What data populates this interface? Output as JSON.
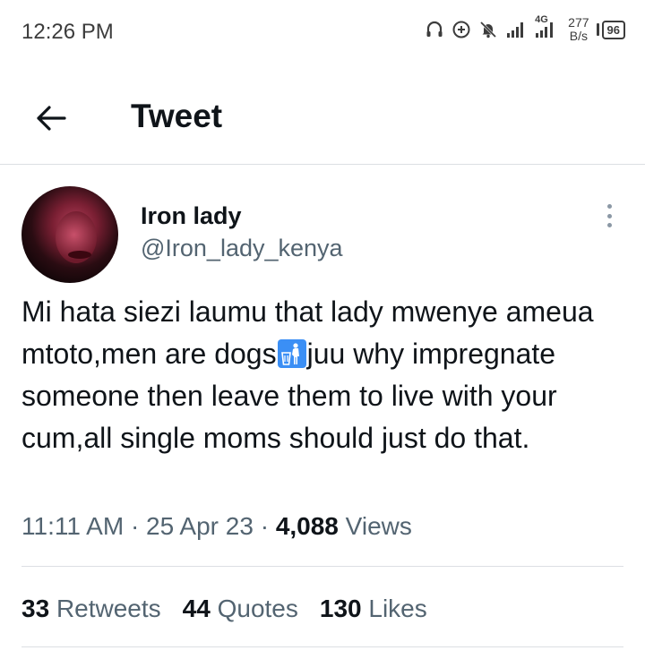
{
  "status_bar": {
    "time": "12:26 PM",
    "network_type": "4G",
    "net_speed_value": "277",
    "net_speed_unit": "B/s",
    "battery": "96",
    "icons": [
      "headphones-icon",
      "data-saver-icon",
      "mute-bell-icon",
      "signal-icon",
      "signal-4g-icon",
      "battery-icon"
    ]
  },
  "header": {
    "title": "Tweet",
    "back_icon": "arrow-left-icon"
  },
  "tweet": {
    "author": {
      "display_name": "Iron lady",
      "handle": "@Iron_lady_kenya"
    },
    "text_part1": "Mi hata siezi laumu that lady mwenye ameua mtoto,men are dogs",
    "emoji": "trash-can-icon",
    "text_part2": "juu why impregnate someone then leave them to live with your cum,all single moms should just do that.",
    "time": "11:11 AM",
    "separator": "·",
    "date": "25 Apr 23",
    "views_count": "4,088",
    "views_label": "Views",
    "stats": {
      "retweets_count": "33",
      "retweets_label": "Retweets",
      "quotes_count": "44",
      "quotes_label": "Quotes",
      "likes_count": "130",
      "likes_label": "Likes"
    }
  },
  "colors": {
    "text_primary": "#0f1419",
    "text_secondary": "#536471",
    "divider": "#dcdfe3",
    "emoji_blue": "#3b8ff5"
  }
}
